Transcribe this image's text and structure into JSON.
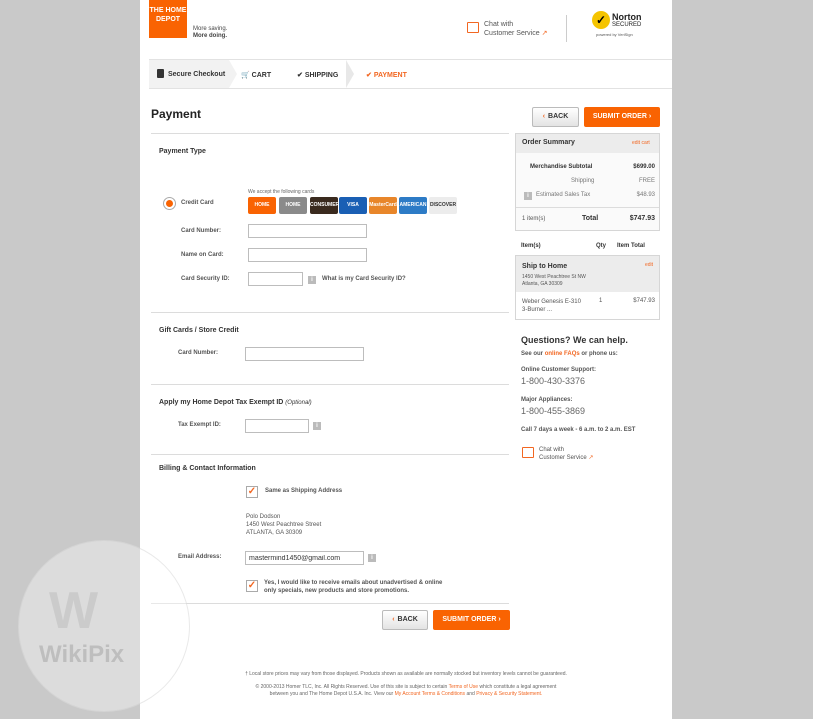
{
  "header": {
    "logo_text": "THE HOME DEPOT",
    "tagline_line1": "More saving.",
    "tagline_line2": "More doing.",
    "chat_line1": "Chat with",
    "chat_line2": "Customer Service",
    "norton_top": "Norton",
    "norton_bottom": "SECURED",
    "norton_powered": "powered by VeriSign"
  },
  "steps": {
    "secure_checkout": "Secure Checkout",
    "cart": "CART",
    "shipping": "SHIPPING",
    "payment": "PAYMENT"
  },
  "page_title": "Payment",
  "buttons": {
    "back": "BACK",
    "submit": "SUBMIT ORDER"
  },
  "payment_type": {
    "heading": "Payment Type",
    "accept_text": "We accept the following cards",
    "option_label": "Credit Card",
    "cards": [
      "HOME DEPOT",
      "HOME DEPOT",
      "CONSUMER",
      "VISA",
      "MasterCard",
      "AMERICAN EXPRESS",
      "DISCOVER"
    ],
    "card_number_label": "Card Number:",
    "name_label": "Name on Card:",
    "security_label": "Card Security ID:",
    "security_help": "What is my Card Security ID?"
  },
  "gift_cards": {
    "heading": "Gift Cards / Store Credit",
    "card_number_label": "Card Number:"
  },
  "tax_exempt": {
    "heading": "Apply my Home Depot Tax Exempt ID",
    "optional": "(Optional)",
    "label": "Tax Exempt ID:"
  },
  "billing": {
    "heading": "Billing & Contact Information",
    "same_as_shipping": "Same as Shipping Address",
    "name": "Polo Dodson",
    "street": "1450 West Peachtree Street",
    "city": "ATLANTA, GA 30309",
    "email_label": "Email Address:",
    "email_value": "mastermind1450@gmail.com",
    "optin_line1": "Yes, I would like to receive emails about unadvertised & online",
    "optin_line2": "only specials, new products and store promotions."
  },
  "order_summary": {
    "title": "Order Summary",
    "edit_cart": "edit cart",
    "subtotal_label": "Merchandise Subtotal",
    "subtotal_value": "$699.00",
    "shipping_label": "Shipping",
    "shipping_value": "FREE",
    "tax_label": "Estimated Sales Tax",
    "tax_value": "$48.93",
    "items_count": "1 item(s)",
    "total_label": "Total",
    "total_value": "$747.93"
  },
  "items_table": {
    "headers": [
      "Item(s)",
      "Qty",
      "Item Total"
    ],
    "ship_to_home": "Ship to Home",
    "edit": "edit",
    "address_line1": "1450 West Peachtree St NW",
    "address_line2": "Atlanta, GA 30309",
    "item_name_line1": "Weber Genesis E-310",
    "item_name_line2": "3-Burner ...",
    "item_qty": "1",
    "item_total": "$747.93"
  },
  "help": {
    "title": "Questions? We can help.",
    "see_our": "See our",
    "faqs": "online FAQs",
    "or_phone": "or phone us:",
    "online_support_label": "Online Customer Support:",
    "online_support_phone": "1-800-430-3376",
    "major_label": "Major Appliances:",
    "major_phone": "1-800-455-3869",
    "hours": "Call 7 days a week - 6 a.m. to 2 a.m. EST",
    "chat_line1": "Chat with",
    "chat_line2": "Customer Service"
  },
  "footer": {
    "disclaimer": "† Local store prices may vary from those displayed. Products shown as available are normally stocked but inventory levels cannot be guaranteed.",
    "copyright_a": "© 2000-2013 Homer TLC, Inc. All Rights Reserved. Use of this site is subject to certain",
    "terms_link": "Terms of Use",
    "copyright_b": "which constitute a legal agreement",
    "copyright_c": "between you and The Home Depot U.S.A. Inc. View our",
    "account_terms_link": "My Account Terms & Conditions",
    "and": "and",
    "privacy_link": "Privacy & Security Statement."
  },
  "watermark": "WikiPix",
  "colors": {
    "accent": "#f96302",
    "link": "#f26722"
  }
}
